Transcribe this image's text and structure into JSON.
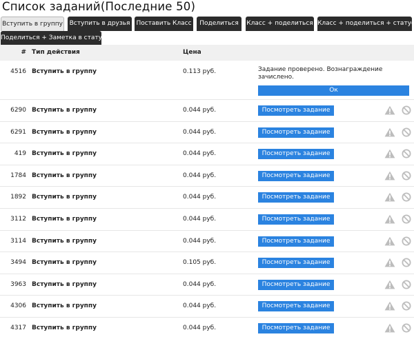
{
  "page": {
    "title": "Список заданий(Последние 50)"
  },
  "tabs": [
    {
      "label": "Вступить в группу",
      "active": true
    },
    {
      "label": "Вступить в друзья",
      "active": false
    },
    {
      "label": "Поставить Класс",
      "active": false
    },
    {
      "label": "Поделиться",
      "active": false
    },
    {
      "label": "Класс + поделиться",
      "active": false
    },
    {
      "label": "Класс + поделиться + статус",
      "active": false
    },
    {
      "label": "Поделиться + Заметка в статус",
      "active": false
    }
  ],
  "table": {
    "headers": {
      "id": "#",
      "type": "Тип действия",
      "price": "Цена"
    },
    "first_row": {
      "id": "4516",
      "type": "Вступить в группу",
      "price": "0.113 руб.",
      "status_text": "Задание проверено. Вознаграждение зачислено.",
      "ok_label": "Ок"
    },
    "view_button_label": "Посмотреть задание",
    "rows": [
      {
        "id": "6290",
        "type": "Вступить в группу",
        "price": "0.044 руб."
      },
      {
        "id": "6291",
        "type": "Вступить в группу",
        "price": "0.044 руб."
      },
      {
        "id": "419",
        "type": "Вступить в группу",
        "price": "0.044 руб."
      },
      {
        "id": "1784",
        "type": "Вступить в группу",
        "price": "0.044 руб."
      },
      {
        "id": "1892",
        "type": "Вступить в группу",
        "price": "0.044 руб."
      },
      {
        "id": "3112",
        "type": "Вступить в группу",
        "price": "0.044 руб."
      },
      {
        "id": "3114",
        "type": "Вступить в группу",
        "price": "0.044 руб."
      },
      {
        "id": "3494",
        "type": "Вступить в группу",
        "price": "0.105 руб."
      },
      {
        "id": "3963",
        "type": "Вступить в группу",
        "price": "0.044 руб."
      },
      {
        "id": "4306",
        "type": "Вступить в группу",
        "price": "0.044 руб."
      },
      {
        "id": "4317",
        "type": "Вступить в группу",
        "price": "0.044 руб."
      }
    ]
  },
  "icons": {
    "row_actions": [
      "warning-icon",
      "block-icon"
    ]
  },
  "colors": {
    "tab_background": "#2c2c2c",
    "tab_active_background": "#e8e8e8",
    "button_blue": "#2b83e0",
    "header_background": "#f0f0f0",
    "icon_gray": "#bdbdbd"
  }
}
